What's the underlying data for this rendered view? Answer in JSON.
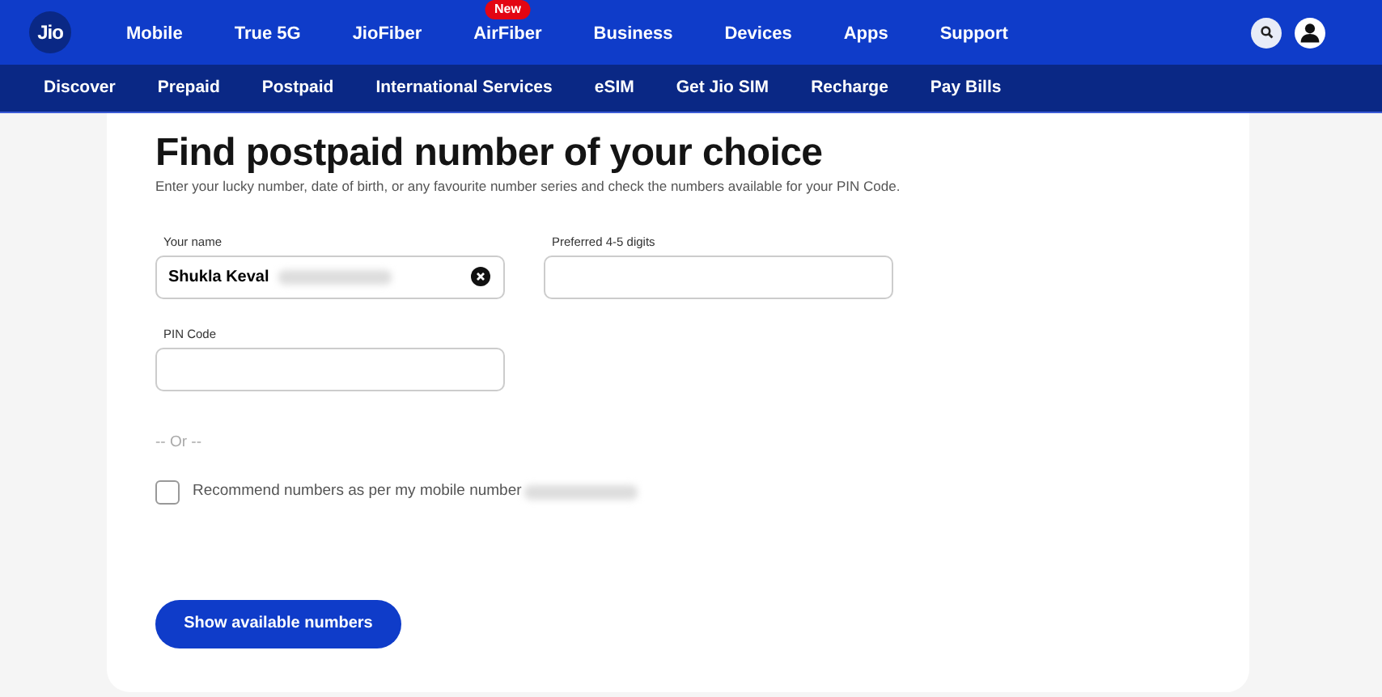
{
  "brand": {
    "logo": "Jio"
  },
  "main_nav": [
    {
      "label": "Mobile"
    },
    {
      "label": "True 5G"
    },
    {
      "label": "JioFiber"
    },
    {
      "label": "AirFiber",
      "badge": "New"
    },
    {
      "label": "Business"
    },
    {
      "label": "Devices"
    },
    {
      "label": "Apps"
    },
    {
      "label": "Support"
    }
  ],
  "sub_nav": [
    {
      "label": "Discover"
    },
    {
      "label": "Prepaid"
    },
    {
      "label": "Postpaid"
    },
    {
      "label": "International Services"
    },
    {
      "label": "eSIM"
    },
    {
      "label": "Get Jio SIM"
    },
    {
      "label": "Recharge"
    },
    {
      "label": "Pay Bills"
    }
  ],
  "form": {
    "title": "Find postpaid number of your choice",
    "subtitle": "Enter your lucky number, date of birth, or any favourite number series and check the numbers available for your PIN Code.",
    "fields": [
      {
        "label": "Your name",
        "value": "Shukla Keval",
        "clearable": true
      },
      {
        "label": "Preferred 4-5 digits"
      },
      {
        "label": "PIN Code"
      }
    ],
    "separator": "-- Or --",
    "recommend": {
      "label": "Recommend numbers as per my mobile number",
      "checked": false
    },
    "submit": "Show available numbers"
  }
}
